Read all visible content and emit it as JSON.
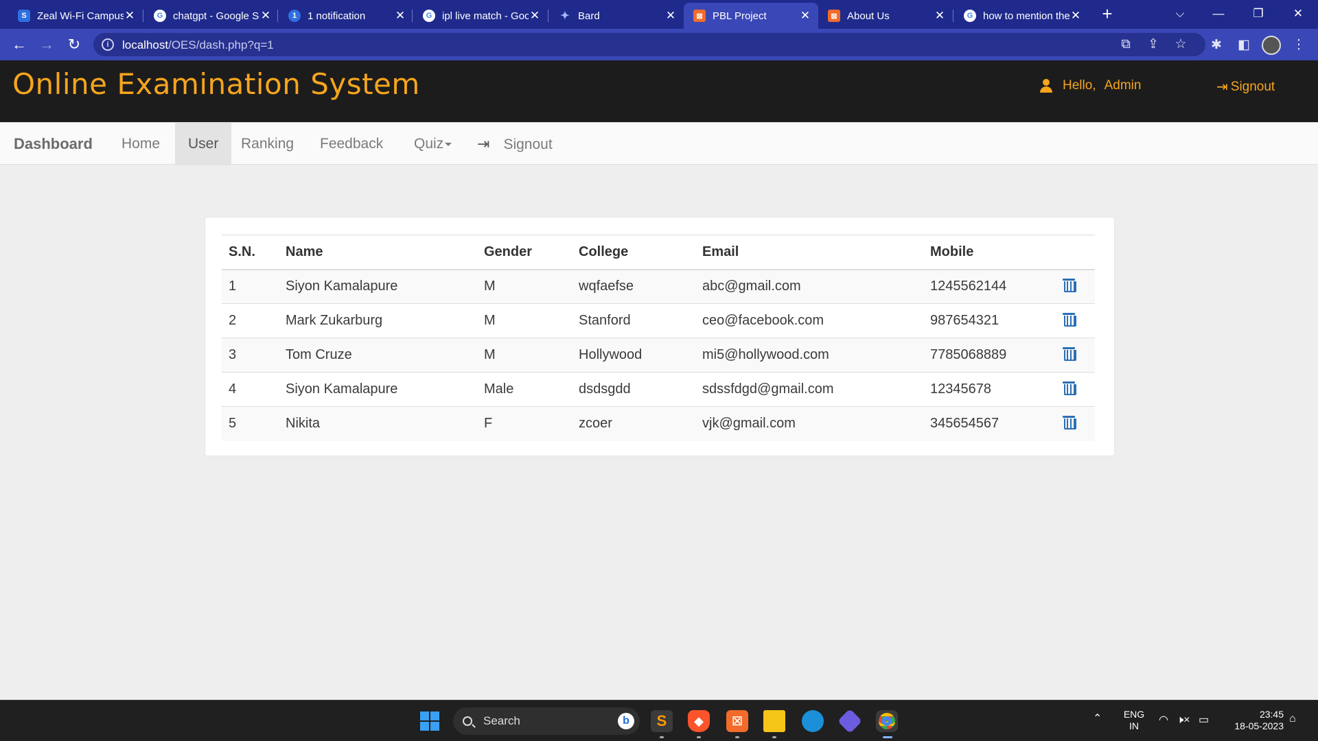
{
  "browser": {
    "tabs": [
      {
        "title": "Zeal Wi-Fi Campus",
        "favicon": "S",
        "favicon_color": "#2f6fe0"
      },
      {
        "title": "chatgpt - Google Search",
        "favicon": "G",
        "favicon_color": "#ffffff"
      },
      {
        "title": "1 notification",
        "favicon": "1",
        "favicon_color": "#2f6fe0"
      },
      {
        "title": "ipl live match - Google",
        "favicon": "G",
        "favicon_color": "#ffffff"
      },
      {
        "title": "Bard",
        "favicon": "✦",
        "favicon_color": "transparent"
      },
      {
        "title": "PBL Project",
        "favicon": "⊠",
        "favicon_color": "#f26b2a"
      },
      {
        "title": "About Us",
        "favicon": "⊠",
        "favicon_color": "#f26b2a"
      },
      {
        "title": "how to mention the",
        "favicon": "G",
        "favicon_color": "#ffffff"
      }
    ],
    "active_tab_index": 5,
    "url_host": "localhost",
    "url_path": "/OES/dash.php?q=1"
  },
  "site": {
    "title": "Online Examination System",
    "hello": "Hello,",
    "user": "Admin",
    "signout": "Signout",
    "accent": "#f6a51d"
  },
  "nav": {
    "brand": "Dashboard",
    "items": [
      "Home",
      "User",
      "Ranking",
      "Feedback",
      "Quiz",
      "Signout"
    ],
    "active": "User"
  },
  "table": {
    "headers": [
      "S.N.",
      "Name",
      "Gender",
      "College",
      "Email",
      "Mobile"
    ],
    "rows": [
      {
        "sn": "1",
        "name": "Siyon Kamalapure",
        "gender": "M",
        "college": "wqfaefse",
        "email": "abc@gmail.com",
        "mobile": "1245562144"
      },
      {
        "sn": "2",
        "name": "Mark Zukarburg",
        "gender": "M",
        "college": "Stanford",
        "email": "ceo@facebook.com",
        "mobile": "987654321"
      },
      {
        "sn": "3",
        "name": "Tom Cruze",
        "gender": "M",
        "college": "Hollywood",
        "email": "mi5@hollywood.com",
        "mobile": "7785068889"
      },
      {
        "sn": "4",
        "name": "Siyon Kamalapure",
        "gender": "Male",
        "college": "dsdsgdd",
        "email": "sdssfdgd@gmail.com",
        "mobile": "12345678"
      },
      {
        "sn": "5",
        "name": "Nikita",
        "gender": "F",
        "college": "zcoer",
        "email": "vjk@gmail.com",
        "mobile": "345654567"
      }
    ],
    "delete_icon": "trash-icon",
    "delete_color": "#2a6fb5"
  },
  "taskbar": {
    "search_label": "Search",
    "lang_top": "ENG",
    "lang_bottom": "IN",
    "time": "23:45",
    "date": "18-05-2023"
  }
}
